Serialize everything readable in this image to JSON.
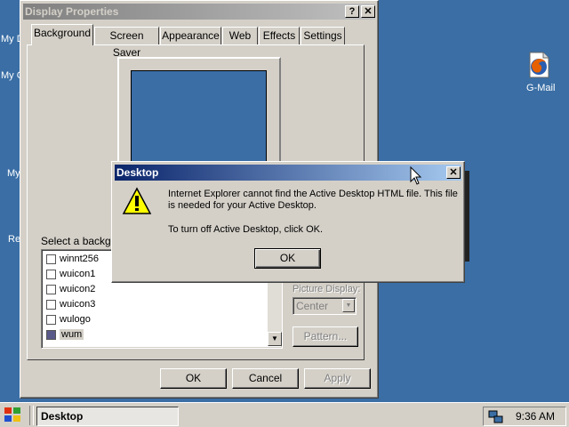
{
  "desktop": {
    "icon_labels_left": [
      "My D",
      "My C",
      "My",
      "Re"
    ],
    "gmail_label": "G-Mail"
  },
  "display_window": {
    "title": "Display Properties",
    "help_glyph": "?",
    "close_glyph": "✕",
    "tabs": [
      "Background",
      "Screen Saver",
      "Appearance",
      "Web",
      "Effects",
      "Settings"
    ],
    "select_label": "Select a backgro",
    "list_items": [
      "winnt256",
      "wuicon1",
      "wuicon2",
      "wuicon3",
      "wulogo",
      "wum"
    ],
    "picture_display_label": "Picture Display:",
    "picture_display_value": "Center",
    "pattern_button": "Pattern...",
    "ok_button": "OK",
    "cancel_button": "Cancel",
    "apply_button": "Apply"
  },
  "dialog": {
    "title": "Desktop",
    "message1": "Internet Explorer cannot find the Active Desktop HTML file. This file is needed for your Active Desktop.",
    "message2": "To turn off Active Desktop, click OK.",
    "ok_button": "OK",
    "icon": "warning-icon"
  },
  "taskbar": {
    "task_label": "Desktop",
    "clock": "9:36 AM"
  },
  "colors": {
    "desktop_bg": "#3a6ea5",
    "active_title": "#0a246a",
    "inactive_title": "#808080"
  }
}
